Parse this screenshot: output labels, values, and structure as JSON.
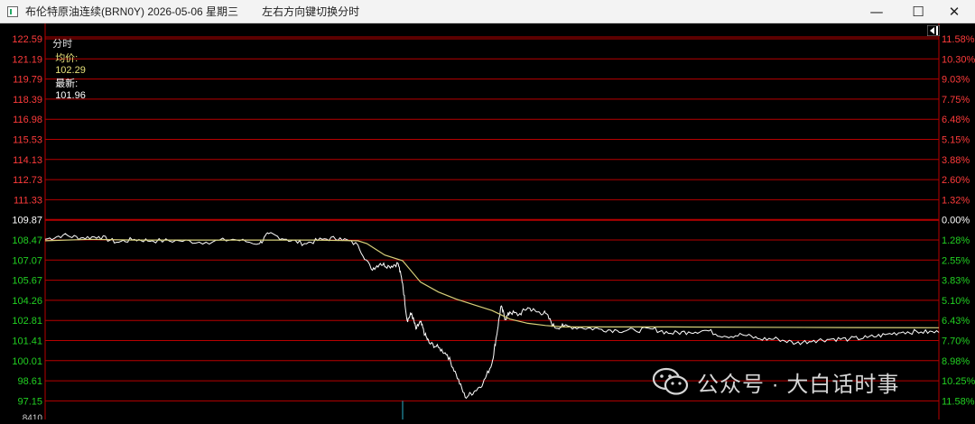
{
  "window": {
    "title": "布伦特原油连续(BRN0Y) 2026-05-06 星期三",
    "hint": "左右方向键切换分时",
    "minimize": "—",
    "maximize": "☐",
    "close": "✕"
  },
  "info": {
    "mode": "分时",
    "avg_label": "均价:",
    "avg": "102.29",
    "last_label": "最新:",
    "last": "101.96"
  },
  "watermark": {
    "text": "公众号 · 大白话时事"
  },
  "colors": {
    "grid_red": "#b80000",
    "up_label": "#ff3b3b",
    "down_label": "#22d022",
    "ref_label": "#ffffff",
    "price_line": "#ffffff",
    "avg_line": "#d8d07a"
  },
  "chart_data": {
    "type": "line",
    "title": "",
    "xlabel": "",
    "ylabel": "",
    "reference_price": 109.87,
    "ylim": [
      97.15,
      122.59
    ],
    "y_ticks_price": [
      "122.59",
      "121.19",
      "119.79",
      "118.39",
      "116.98",
      "115.53",
      "114.13",
      "112.73",
      "111.33",
      "109.87",
      "108.47",
      "107.07",
      "105.67",
      "104.26",
      "102.81",
      "101.41",
      "100.01",
      "98.61",
      "97.15"
    ],
    "y_ticks_pct": [
      "11.58%",
      "10.30%",
      "9.03%",
      "7.75%",
      "6.48%",
      "5.15%",
      "3.88%",
      "2.60%",
      "1.32%",
      "0.00%",
      "1.28%",
      "2.55%",
      "3.83%",
      "5.10%",
      "6.43%",
      "7.70%",
      "8.98%",
      "10.25%",
      "11.58%"
    ],
    "bottom_label": "8410",
    "series": [
      {
        "key": "price",
        "x": [
          0,
          0.02,
          0.04,
          0.06,
          0.08,
          0.1,
          0.12,
          0.15,
          0.18,
          0.21,
          0.24,
          0.25,
          0.27,
          0.29,
          0.31,
          0.33,
          0.35,
          0.365,
          0.375,
          0.385,
          0.395,
          0.4,
          0.405,
          0.41,
          0.415,
          0.42,
          0.425,
          0.43,
          0.44,
          0.45,
          0.46,
          0.47,
          0.48,
          0.49,
          0.5,
          0.505,
          0.51,
          0.515,
          0.52,
          0.53,
          0.54,
          0.55,
          0.56,
          0.57,
          0.58,
          0.6,
          0.62,
          0.64,
          0.66,
          0.68,
          0.7,
          0.72,
          0.74,
          0.76,
          0.78,
          0.8,
          0.82,
          0.84,
          0.86,
          0.88,
          0.9,
          0.92,
          0.94,
          0.96,
          0.98,
          1.0
        ],
        "values": [
          108.5,
          108.8,
          108.6,
          108.7,
          108.3,
          108.5,
          108.4,
          108.4,
          108.3,
          108.5,
          108.2,
          108.9,
          108.5,
          108.2,
          108.5,
          108.6,
          108.1,
          106.4,
          106.8,
          106.6,
          106.8,
          105.4,
          102.8,
          103.3,
          102.2,
          102.7,
          101.8,
          101.2,
          100.9,
          100.4,
          99.0,
          97.4,
          97.8,
          98.4,
          99.8,
          101.7,
          103.8,
          102.9,
          103.4,
          103.2,
          103.7,
          103.4,
          103.3,
          102.3,
          102.4,
          102.3,
          102.2,
          102.1,
          102.1,
          102.2,
          101.9,
          102.0,
          102.1,
          101.7,
          101.8,
          101.5,
          101.5,
          101.2,
          101.4,
          101.5,
          101.5,
          101.6,
          101.8,
          102.0,
          102.0,
          101.96
        ]
      },
      {
        "key": "average",
        "x": [
          0,
          0.05,
          0.1,
          0.2,
          0.3,
          0.35,
          0.36,
          0.37,
          0.38,
          0.4,
          0.42,
          0.44,
          0.46,
          0.48,
          0.5,
          0.52,
          0.54,
          0.56,
          0.58,
          0.6,
          0.65,
          0.7,
          0.8,
          0.9,
          1.0
        ],
        "values": [
          108.4,
          108.5,
          108.45,
          108.45,
          108.45,
          108.4,
          108.2,
          107.8,
          107.4,
          107.0,
          105.5,
          104.8,
          104.3,
          103.9,
          103.5,
          102.9,
          102.6,
          102.45,
          102.35,
          102.35,
          102.35,
          102.35,
          102.32,
          102.3,
          102.29
        ]
      }
    ]
  }
}
